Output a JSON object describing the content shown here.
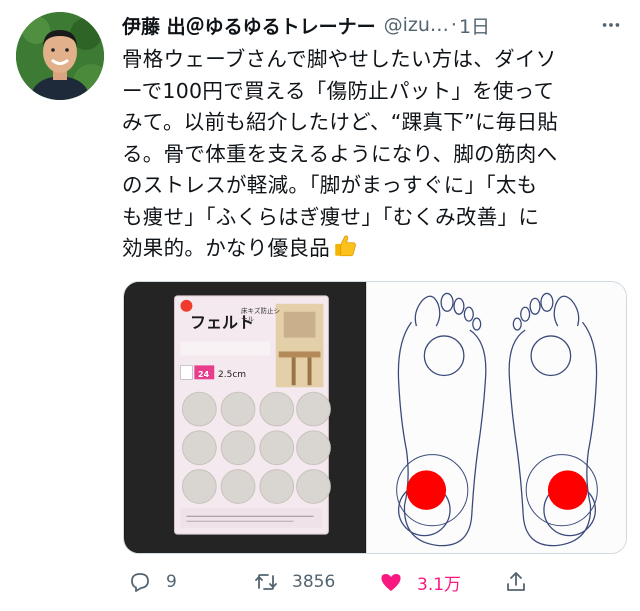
{
  "author": {
    "display_name": "伊藤 出＠ゆるゆるトレーナー",
    "handle": "@izu…",
    "separator": "·",
    "time": "1日"
  },
  "tweet": {
    "lines": [
      "骨格ウェーブさんで脚やせしたい方は、ダイソ",
      "ーで100円で買える「傷防止パット」を使って",
      "みて。以前も紹介したけど、“踝真下”に毎日貼",
      "る。骨で体重を支えるようになり、脚の筋肉へ",
      "のストレスが軽減。「脚がまっすぐに」「太も",
      "も痩せ」「ふくらはぎ痩せ」「むくみ改善」に",
      "効果的。かなり優良品"
    ],
    "emoji": "thumbs-up"
  },
  "media": {
    "product": {
      "brand_text": "フェルト",
      "sub_text": "床キズ防止シール",
      "count_text": "24",
      "size_text": "2.5cm"
    },
    "diagram_marker_color": "#ff0000"
  },
  "actions": {
    "reply_count": "9",
    "retweet_count": "3856",
    "like_count": "3.1万",
    "like_color": "#f91880"
  }
}
